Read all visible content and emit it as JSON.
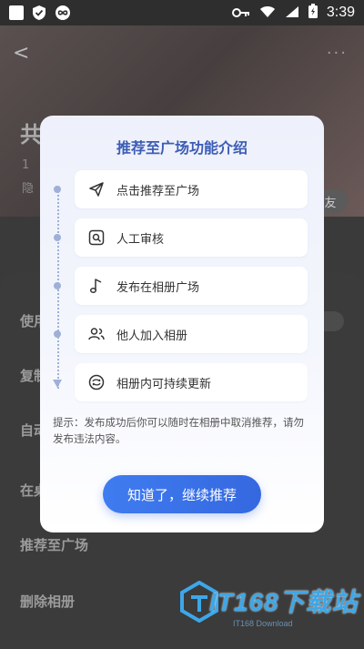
{
  "status_bar": {
    "time": "3:39"
  },
  "background": {
    "title": "共",
    "subtitle": "1",
    "subtitle2": "隐",
    "friend_button": "友",
    "sheet_items": [
      "使用",
      "复制",
      "自动",
      "在桌",
      "推荐至广场",
      "删除相册"
    ]
  },
  "modal": {
    "title": "推荐至广场功能介绍",
    "steps": [
      {
        "icon": "send-icon",
        "label": "点击推荐至广场"
      },
      {
        "icon": "review-icon",
        "label": "人工审核"
      },
      {
        "icon": "music-note-icon",
        "label": "发布在相册广场"
      },
      {
        "icon": "users-icon",
        "label": "他人加入相册"
      },
      {
        "icon": "refresh-icon",
        "label": "相册内可持续更新"
      }
    ],
    "tip": "提示：发布成功后你可以随时在相册中取消推荐，请勿发布违法内容。",
    "confirm_button": "知道了，继续推荐"
  },
  "watermark": {
    "main": "IT168下载站",
    "sub": "IT168 Download"
  },
  "colors": {
    "accent": "#3f7cf0",
    "title": "#3b5db5",
    "timeline": "#9fb0d6"
  }
}
